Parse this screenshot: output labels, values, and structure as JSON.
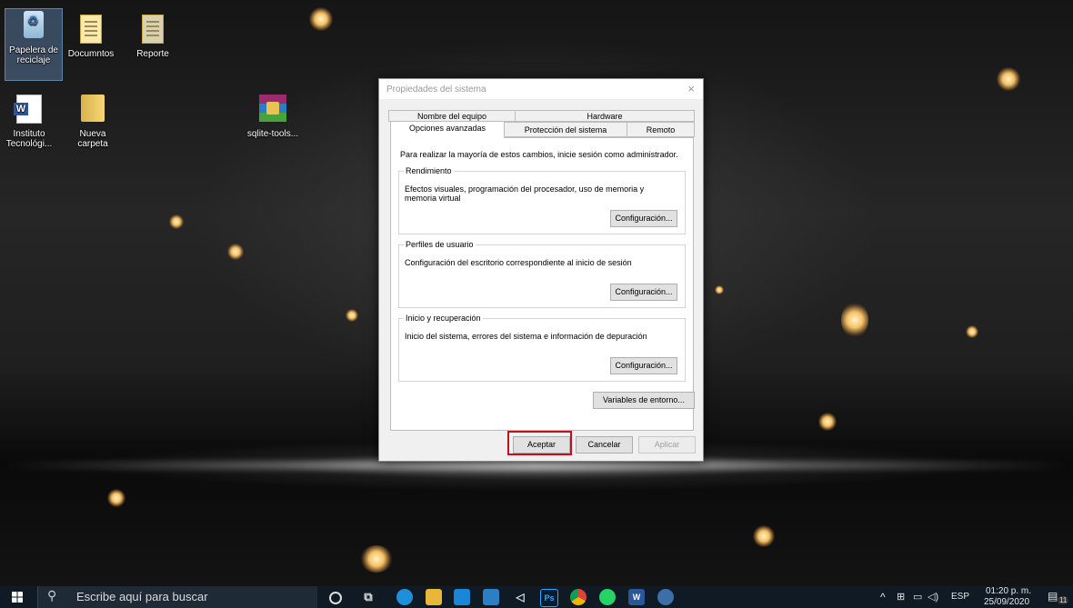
{
  "desktop": {
    "icons": [
      {
        "label": "Papelera de reciclaje"
      },
      {
        "label": "Documntos"
      },
      {
        "label": "Reporte"
      },
      {
        "label": "Instituto Tecnológi..."
      },
      {
        "label": "Nueva carpeta"
      },
      {
        "label": "sqlite-tools..."
      }
    ]
  },
  "dialog": {
    "title": "Propiedades del sistema",
    "close": "×",
    "tabs": [
      "Nombre del equipo",
      "Hardware",
      "Opciones avanzadas",
      "Protección del sistema",
      "Remoto"
    ],
    "intro": "Para realizar la mayoría de estos cambios, inicie sesión como administrador.",
    "groups": [
      {
        "legend": "Rendimiento",
        "desc": "Efectos visuales, programación del procesador, uso de memoria y memoria virtual",
        "button": "Configuración..."
      },
      {
        "legend": "Perfiles de usuario",
        "desc": "Configuración del escritorio correspondiente al inicio de sesión",
        "button": "Configuración..."
      },
      {
        "legend": "Inicio y recuperación",
        "desc": "Inicio del sistema, errores del sistema e información de depuración",
        "button": "Configuración..."
      }
    ],
    "env_button": "Variables de entorno...",
    "ok": "Aceptar",
    "cancel": "Cancelar",
    "apply": "Aplicar"
  },
  "taskbar": {
    "search_placeholder": "Escribe aquí para buscar",
    "apps": [
      "cortana",
      "task-view",
      "edge",
      "file-explorer",
      "store",
      "mail",
      "media",
      "photoshop",
      "chrome",
      "whatsapp",
      "word",
      "people"
    ],
    "language": "ESP",
    "time": "01:20 p. m.",
    "date": "25/09/2020",
    "notification_count": "11"
  },
  "colors": {
    "highlight": "#c4101e",
    "taskbar": "#0f1a24"
  }
}
